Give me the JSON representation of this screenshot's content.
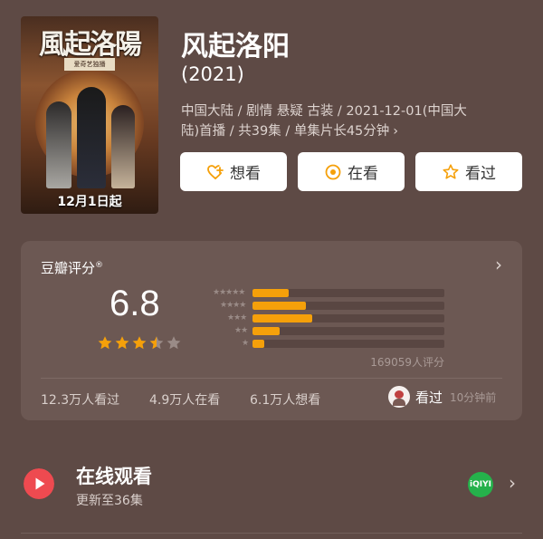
{
  "show": {
    "title": "风起洛阳",
    "year": "(2021)",
    "meta_line1": "中国大陆 / 剧情 悬疑 古装 / 2021-12-01(中国大",
    "meta_line2": "陆)首播 / 共39集 / 单集片长45分钟",
    "meta_chevron": "›"
  },
  "poster": {
    "title_text": "風起洛陽",
    "subtitle_text": "爱奇艺独播",
    "date_text": "12月1日起"
  },
  "actions": {
    "want": "想看",
    "watching": "在看",
    "watched": "看过"
  },
  "rating": {
    "title": "豆瓣评分",
    "title_mark": "®",
    "chevron": "›",
    "score": "6.8",
    "stars_value": 3.5,
    "star_labels": [
      "★★★★★",
      "★★★★",
      "★★★",
      "★★",
      "★"
    ],
    "distribution_percent": [
      19,
      28,
      31,
      14,
      6
    ],
    "count": "169059人评分",
    "stats": {
      "watched": "12.3万人看过",
      "watching": "4.9万人在看",
      "want": "6.1万人想看"
    },
    "recent": {
      "label": "看过",
      "time": "10分钟前"
    }
  },
  "watch": {
    "title": "在线观看",
    "subtitle": "更新至36集",
    "provider": "iQIYI",
    "chevron": "›"
  },
  "colors": {
    "background": "#5e4a45",
    "card": "#6c5853",
    "bar_fill": "#f5a00a",
    "star_on": "#f5a00a",
    "star_off": "#9a8b87",
    "accent_orange": "#f5a00a",
    "play_red": "#ee4a50",
    "iqiyi_green": "#25b14b"
  },
  "icons": {
    "want": "heart-plus-icon",
    "watching": "target-circle-icon",
    "watched": "star-outline-icon",
    "play": "play-icon",
    "provider": "iqiyi-logo-icon"
  }
}
